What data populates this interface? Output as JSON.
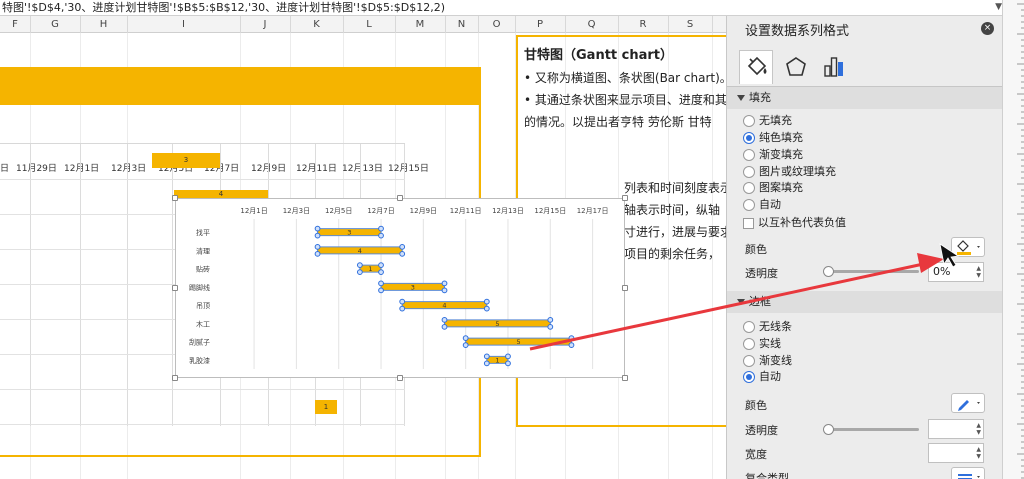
{
  "formula": "特图'!$D$4,'30、进度计划甘特图'!$B$5:$B$12,'30、进度计划甘特图'!$D$5:$D$12,2)",
  "columns": [
    {
      "label": "F"
    },
    {
      "label": "G"
    },
    {
      "label": "H"
    },
    {
      "label": "I"
    },
    {
      "label": "J"
    },
    {
      "label": "K"
    },
    {
      "label": "L"
    },
    {
      "label": "M"
    },
    {
      "label": "N"
    },
    {
      "label": "O"
    },
    {
      "label": "P"
    },
    {
      "label": "Q"
    },
    {
      "label": "R"
    },
    {
      "label": "S"
    }
  ],
  "bg_gantt": {
    "dates": [
      "日",
      "11月29日",
      "12月1日",
      "12月3日",
      "12月5日",
      "12月7日",
      "12月9日",
      "12月11日",
      "12月13日",
      "12月15日"
    ],
    "bar_labels": [
      "3",
      "4",
      "1"
    ]
  },
  "textbox": {
    "title": "甘特图（Gantt chart）",
    "lines": [
      "• 又称为横道图、条状图(Bar chart)。",
      "• 其通过条状图来显示项目、进度和其",
      "的情况。以提出者亨特 劳伦斯 甘特",
      "",
      "",
      "列表和时间刻度表示",
      "轴表示时间，纵轴",
      "寸进行，进展与要求",
      "项目的剩余任务，"
    ]
  },
  "chart_data": {
    "type": "bar",
    "title": "",
    "xlabel": "",
    "ylabel": "",
    "x_ticks": [
      "12月1日",
      "12月3日",
      "12月5日",
      "12月7日",
      "12月9日",
      "12月11日",
      "12月13日",
      "12月15日",
      "12月17日"
    ],
    "x_tick_values": [
      1,
      3,
      5,
      7,
      9,
      11,
      13,
      15,
      17
    ],
    "xlim": [
      -0.8,
      18.2
    ],
    "categories": [
      "找平",
      "清理",
      "贴砖",
      "踢脚线",
      "吊顶",
      "木工",
      "刮腻子",
      "乳胶漆"
    ],
    "series": [
      {
        "name": "",
        "values": [
          3,
          4,
          1,
          3,
          4,
          5,
          5,
          1
        ],
        "start": [
          4,
          4,
          6,
          7,
          8,
          10,
          11,
          12
        ]
      }
    ],
    "bar_color": "#f5b400",
    "grid": true
  },
  "panel": {
    "title": "设置数据系列格式",
    "close": "×",
    "tabs": [
      {
        "icon": "paint-bucket-icon"
      },
      {
        "icon": "pentagon-icon"
      },
      {
        "icon": "bar-chart-icon"
      }
    ],
    "fill_section": "填充",
    "fill_options": [
      {
        "label": "无填充",
        "checked": false
      },
      {
        "label": "纯色填充",
        "checked": true
      },
      {
        "label": "渐变填充",
        "checked": false
      },
      {
        "label": "图片或纹理填充",
        "checked": false
      },
      {
        "label": "图案填充",
        "checked": false
      },
      {
        "label": "自动",
        "checked": false
      }
    ],
    "invert_label": "以互补色代表负值",
    "color_label": "颜色",
    "transparency_label": "透明度",
    "transparency_value": "0%",
    "border_section": "边框",
    "border_options": [
      {
        "label": "无线条",
        "checked": false
      },
      {
        "label": "实线",
        "checked": false
      },
      {
        "label": "渐变线",
        "checked": false
      },
      {
        "label": "自动",
        "checked": true
      }
    ],
    "border_color_label": "颜色",
    "border_transparency_label": "透明度",
    "width_label": "宽度",
    "compound_label": "复合类型"
  },
  "colors": {
    "accent": "#f5b400",
    "arrow": "#e8383d",
    "radio": "#2f6fdc"
  }
}
